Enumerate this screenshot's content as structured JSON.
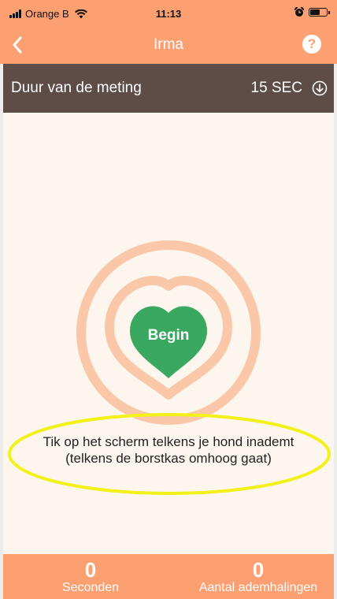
{
  "status_bar": {
    "carrier": "Orange B",
    "time": "11:13"
  },
  "nav": {
    "title": "Irma",
    "help_label": "?"
  },
  "duration": {
    "label": "Duur van de meting",
    "value": "15 SEC"
  },
  "main": {
    "begin_label": "Begin",
    "instruction_line1": "Tik op het scherm telkens je hond inademt",
    "instruction_line2": "(telkens de borstkas omhoog gaat)"
  },
  "counters": {
    "seconds_value": "0",
    "seconds_label": "Seconden",
    "breaths_value": "0",
    "breaths_label": "Aantal ademhalingen"
  },
  "colors": {
    "accent": "#fc9f71",
    "dark_bar": "#5e4d47",
    "background": "#fdf6ee",
    "heart_fill": "#3aa861",
    "ring": "#fbc7a9",
    "highlight": "#f2f21a"
  },
  "icons": {
    "back": "chevron-left-icon",
    "help": "question-circle-icon",
    "duration": "arrow-down-circle-icon",
    "signal": "signal-bars-icon",
    "wifi": "wifi-icon",
    "alarm": "alarm-clock-icon",
    "battery": "battery-icon"
  }
}
